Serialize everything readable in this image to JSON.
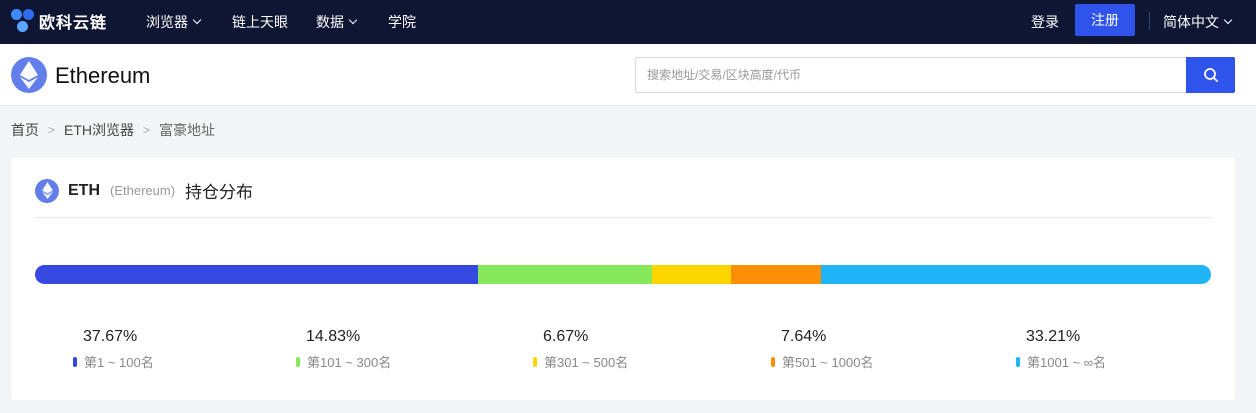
{
  "nav": {
    "brand": "欧科云链",
    "items": [
      "浏览器",
      "链上天眼",
      "数据",
      "学院"
    ],
    "login": "登录",
    "register": "注册",
    "language": "简体中文"
  },
  "header": {
    "title": "Ethereum",
    "search_placeholder": "搜索地址/交易/区块高度/代币"
  },
  "breadcrumb": {
    "home": "首页",
    "explorer": "ETH浏览器",
    "current": "富豪地址",
    "separator": ">"
  },
  "card": {
    "symbol": "ETH",
    "name": "(Ethereum)",
    "title": "持仓分布"
  },
  "distribution": [
    {
      "percent": "37.67%",
      "value": 37.67,
      "range": "第1 ~ 100名",
      "color": "#3549e0"
    },
    {
      "percent": "14.83%",
      "value": 14.83,
      "range": "第101 ~ 300名",
      "color": "#86e85a"
    },
    {
      "percent": "6.67%",
      "value": 6.67,
      "range": "第301 ~ 500名",
      "color": "#fdd600"
    },
    {
      "percent": "7.64%",
      "value": 7.64,
      "range": "第501 ~ 1000名",
      "color": "#fd8f07"
    },
    {
      "percent": "33.21%",
      "value": 33.21,
      "range": "第1001 ~ ∞名",
      "color": "#1eb4f5"
    }
  ],
  "icons": {
    "search": "search-icon",
    "eth": "ethereum-icon",
    "dropdown": "chevron-down-icon"
  }
}
